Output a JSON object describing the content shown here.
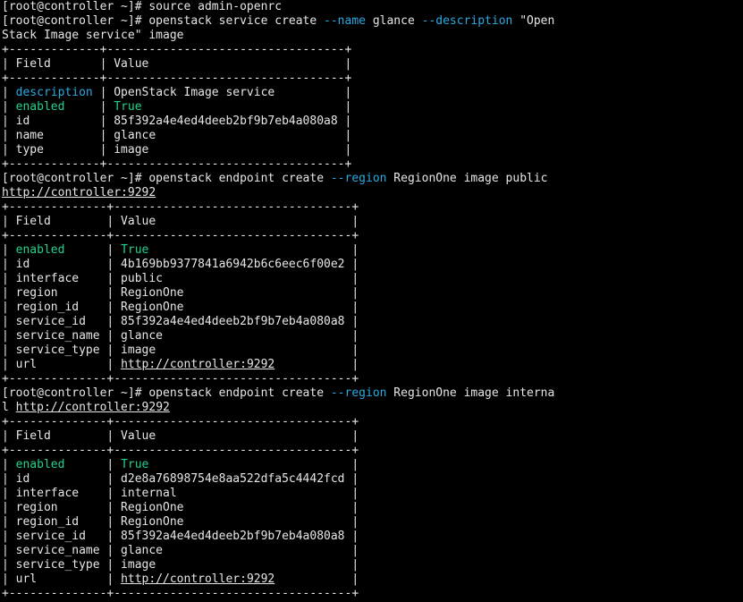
{
  "colors": {
    "background": "#000000",
    "foreground": "#e6e6e6",
    "option_flag": "#2ca9e1",
    "highlight_green": "#23d18b"
  },
  "terminal": {
    "lines": [
      [
        {
          "t": "[root@controller ~]# source admin-openrc",
          "c": "plain"
        }
      ],
      [
        {
          "t": "[root@controller ~]# openstack service create ",
          "c": "plain"
        },
        {
          "t": "--name",
          "c": "desc"
        },
        {
          "t": " glance ",
          "c": "plain"
        },
        {
          "t": "--description",
          "c": "desc"
        },
        {
          "t": " \"Open",
          "c": "plain"
        }
      ],
      [
        {
          "t": "Stack Image service\" image",
          "c": "plain"
        }
      ],
      [
        {
          "t": "+-------------+----------------------------------+",
          "c": "plain"
        }
      ],
      [
        {
          "t": "| Field       | Value                            |",
          "c": "plain"
        }
      ],
      [
        {
          "t": "+-------------+----------------------------------+",
          "c": "plain"
        }
      ],
      [
        {
          "t": "| ",
          "c": "plain"
        },
        {
          "t": "description",
          "c": "desc"
        },
        {
          "t": " | OpenStack Image service          |",
          "c": "plain"
        }
      ],
      [
        {
          "t": "| ",
          "c": "plain"
        },
        {
          "t": "enabled",
          "c": "green"
        },
        {
          "t": "     | ",
          "c": "plain"
        },
        {
          "t": "True",
          "c": "green"
        },
        {
          "t": "                             |",
          "c": "plain"
        }
      ],
      [
        {
          "t": "| id          | 85f392a4e4ed4deeb2bf9b7eb4a080a8 |",
          "c": "plain"
        }
      ],
      [
        {
          "t": "| name        | glance                           |",
          "c": "plain"
        }
      ],
      [
        {
          "t": "| type        | image                            |",
          "c": "plain"
        }
      ],
      [
        {
          "t": "+-------------+----------------------------------+",
          "c": "plain"
        }
      ],
      [
        {
          "t": "[root@controller ~]# openstack endpoint create ",
          "c": "plain"
        },
        {
          "t": "--region",
          "c": "desc"
        },
        {
          "t": " RegionOne image public",
          "c": "plain"
        }
      ],
      [
        {
          "t": "http://controller:9292",
          "c": "link"
        }
      ],
      [
        {
          "t": "+--------------+----------------------------------+",
          "c": "plain"
        }
      ],
      [
        {
          "t": "| Field        | Value                            |",
          "c": "plain"
        }
      ],
      [
        {
          "t": "+--------------+----------------------------------+",
          "c": "plain"
        }
      ],
      [
        {
          "t": "| ",
          "c": "plain"
        },
        {
          "t": "enabled",
          "c": "green"
        },
        {
          "t": "      | ",
          "c": "plain"
        },
        {
          "t": "True",
          "c": "green"
        },
        {
          "t": "                             |",
          "c": "plain"
        }
      ],
      [
        {
          "t": "| id           | 4b169bb9377841a6942b6c6eec6f00e2 |",
          "c": "plain"
        }
      ],
      [
        {
          "t": "| interface    | public                           |",
          "c": "plain"
        }
      ],
      [
        {
          "t": "| region       | RegionOne                        |",
          "c": "plain"
        }
      ],
      [
        {
          "t": "| region_id    | RegionOne                        |",
          "c": "plain"
        }
      ],
      [
        {
          "t": "| service_id   | 85f392a4e4ed4deeb2bf9b7eb4a080a8 |",
          "c": "plain"
        }
      ],
      [
        {
          "t": "| service_name | glance                           |",
          "c": "plain"
        }
      ],
      [
        {
          "t": "| service_type | image                            |",
          "c": "plain"
        }
      ],
      [
        {
          "t": "| url          | ",
          "c": "plain"
        },
        {
          "t": "http://controller:9292",
          "c": "link"
        },
        {
          "t": "           |",
          "c": "plain"
        }
      ],
      [
        {
          "t": "+--------------+----------------------------------+",
          "c": "plain"
        }
      ],
      [
        {
          "t": "[root@controller ~]# openstack endpoint create ",
          "c": "plain"
        },
        {
          "t": "--region",
          "c": "desc"
        },
        {
          "t": " RegionOne image interna",
          "c": "plain"
        }
      ],
      [
        {
          "t": "l ",
          "c": "plain"
        },
        {
          "t": "http://controller:9292",
          "c": "link"
        }
      ],
      [
        {
          "t": "+--------------+----------------------------------+",
          "c": "plain"
        }
      ],
      [
        {
          "t": "| Field        | Value                            |",
          "c": "plain"
        }
      ],
      [
        {
          "t": "+--------------+----------------------------------+",
          "c": "plain"
        }
      ],
      [
        {
          "t": "| ",
          "c": "plain"
        },
        {
          "t": "enabled",
          "c": "green"
        },
        {
          "t": "      | ",
          "c": "plain"
        },
        {
          "t": "True",
          "c": "green"
        },
        {
          "t": "                             |",
          "c": "plain"
        }
      ],
      [
        {
          "t": "| id           | d2e8a76898754e8aa522dfa5c4442fcd |",
          "c": "plain"
        }
      ],
      [
        {
          "t": "| interface    | internal                         |",
          "c": "plain"
        }
      ],
      [
        {
          "t": "| region       | RegionOne                        |",
          "c": "plain"
        }
      ],
      [
        {
          "t": "| region_id    | RegionOne                        |",
          "c": "plain"
        }
      ],
      [
        {
          "t": "| service_id   | 85f392a4e4ed4deeb2bf9b7eb4a080a8 |",
          "c": "plain"
        }
      ],
      [
        {
          "t": "| service_name | glance                           |",
          "c": "plain"
        }
      ],
      [
        {
          "t": "| service_type | image                            |",
          "c": "plain"
        }
      ],
      [
        {
          "t": "| url          | ",
          "c": "plain"
        },
        {
          "t": "http://controller:9292",
          "c": "link"
        },
        {
          "t": "           |",
          "c": "plain"
        }
      ],
      [
        {
          "t": "+--------------+----------------------------------+",
          "c": "plain"
        }
      ]
    ]
  }
}
